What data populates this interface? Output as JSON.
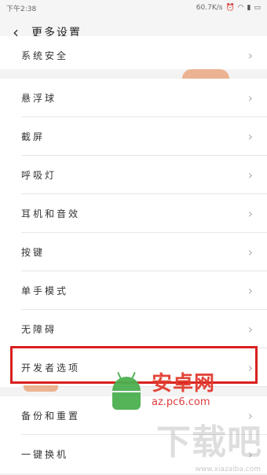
{
  "status_bar": {
    "time": "下午2:38",
    "network": "60.7K/s",
    "icons": [
      "alarm-icon",
      "wifi-icon",
      "signal-icon",
      "battery-icon"
    ]
  },
  "header": {
    "title": "更多设置",
    "back_icon": "back-arrow-icon"
  },
  "menu": {
    "items": [
      {
        "label": "系统安全"
      },
      {
        "label": "悬浮球"
      },
      {
        "label": "截屏"
      },
      {
        "label": "呼吸灯"
      },
      {
        "label": "耳机和音效"
      },
      {
        "label": "按键"
      },
      {
        "label": "单手模式"
      },
      {
        "label": "无障碍"
      },
      {
        "label": "开发者选项"
      },
      {
        "label": "备份和重置"
      },
      {
        "label": "一键换机"
      }
    ]
  },
  "watermark": {
    "brand": "安卓网",
    "url": "az.pc6.com",
    "brand2": "下载吧",
    "url2": "www.xiazaiba.com"
  },
  "colors": {
    "highlight": "#d9201f",
    "android_green": "#4caf50",
    "brand_red": "#e23b2e"
  }
}
